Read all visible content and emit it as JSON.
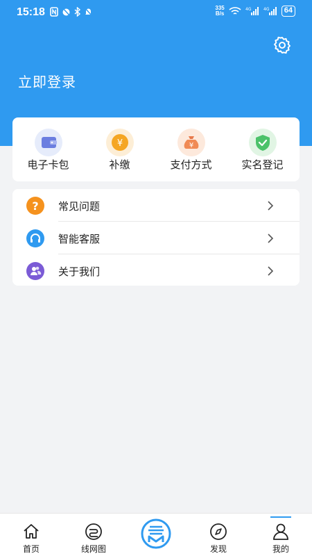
{
  "status_bar": {
    "time": "15:18",
    "net_speed_value": "335",
    "net_speed_unit": "B/s",
    "battery": "64"
  },
  "header": {
    "login_label": "立即登录"
  },
  "quick_actions": [
    {
      "label": "电子卡包",
      "icon": "wallet-icon"
    },
    {
      "label": "补缴",
      "icon": "yuan-coin-icon"
    },
    {
      "label": "支付方式",
      "icon": "money-bag-icon"
    },
    {
      "label": "实名登记",
      "icon": "shield-check-icon"
    }
  ],
  "menu": [
    {
      "label": "常见问题",
      "icon": "question-icon",
      "color": "#f5921e"
    },
    {
      "label": "智能客服",
      "icon": "headset-icon",
      "color": "#2f9af0"
    },
    {
      "label": "关于我们",
      "icon": "people-icon",
      "color": "#7b5bd6"
    }
  ],
  "tabbar": [
    {
      "label": "首页",
      "icon": "home-icon"
    },
    {
      "label": "线网图",
      "icon": "route-map-icon"
    },
    {
      "label": "",
      "icon": "metro-logo-icon"
    },
    {
      "label": "发现",
      "icon": "compass-icon"
    },
    {
      "label": "我的",
      "icon": "user-icon"
    }
  ],
  "colors": {
    "brand": "#2f9af0",
    "background": "#f2f3f5"
  }
}
